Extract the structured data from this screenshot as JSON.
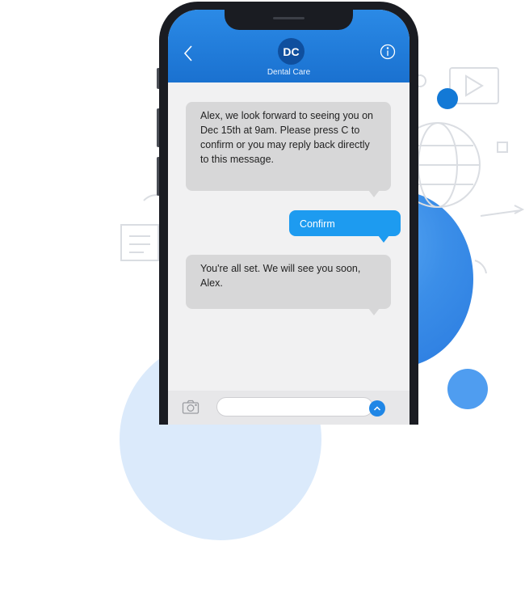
{
  "header": {
    "avatar_initials": "DC",
    "contact_name": "Dental Care"
  },
  "messages": [
    {
      "direction": "incoming",
      "text": "Alex, we look forward to seeing you on Dec 15th at 9am. Please press C to confirm or you may reply back directly to this message."
    },
    {
      "direction": "outgoing",
      "text": "Confirm"
    },
    {
      "direction": "incoming",
      "text": "You're all set. We will see you soon, Alex."
    }
  ],
  "composer": {
    "placeholder": ""
  },
  "icons": {
    "back": "chevron-left-icon",
    "info": "info-icon",
    "camera": "camera-icon",
    "send": "send-arrow-up-icon"
  },
  "colors": {
    "header_blue": "#1f7ddb",
    "outgoing_bubble": "#1d9bf0",
    "incoming_bubble": "#d7d7d8",
    "avatar": "#0f4f9e"
  }
}
